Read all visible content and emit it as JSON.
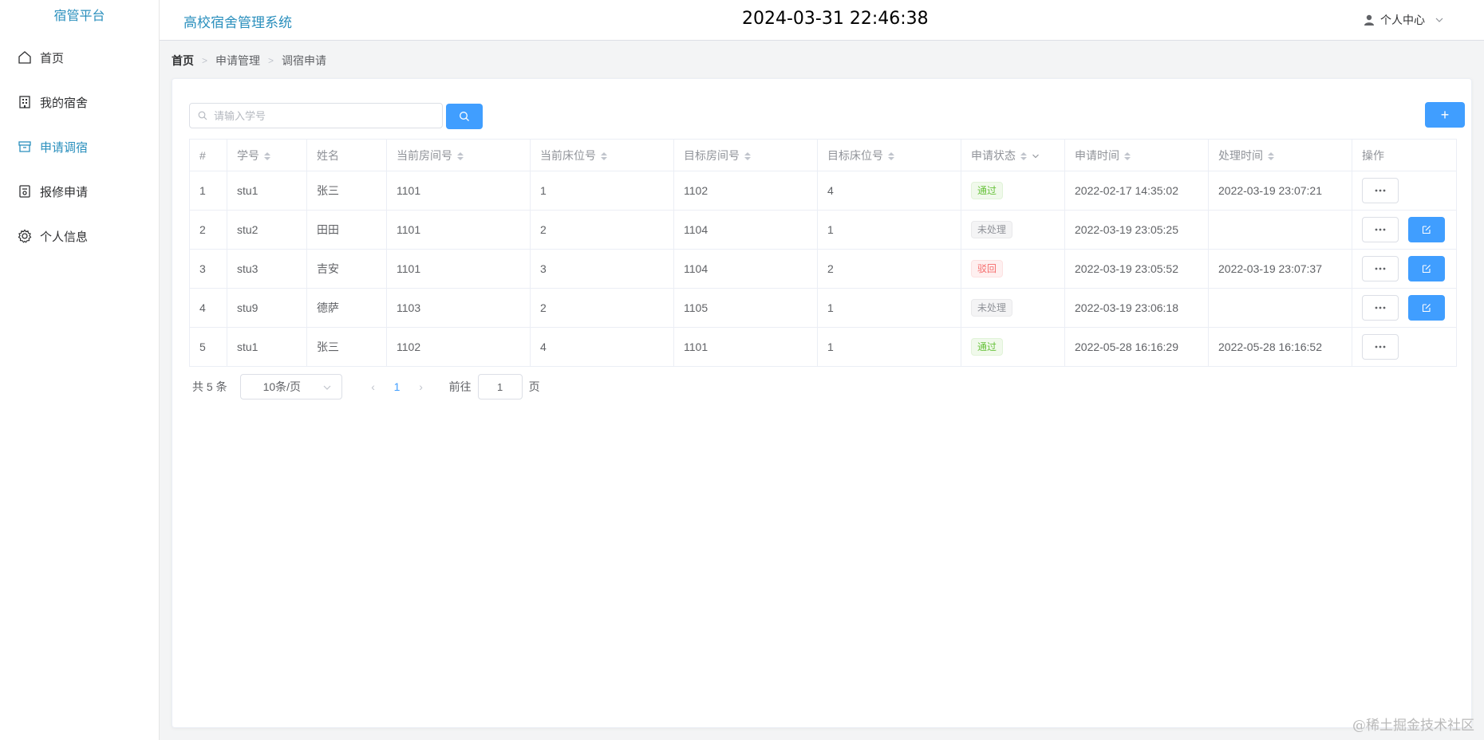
{
  "sidebar": {
    "brand": "宿管平台",
    "items": [
      {
        "label": "首页",
        "icon": "home-icon",
        "active": false
      },
      {
        "label": "我的宿舍",
        "icon": "building-icon",
        "active": false
      },
      {
        "label": "申请调宿",
        "icon": "box-icon",
        "active": true
      },
      {
        "label": "报修申请",
        "icon": "wrench-icon",
        "active": false
      },
      {
        "label": "个人信息",
        "icon": "gear-icon",
        "active": false
      }
    ]
  },
  "header": {
    "title": "高校宿舍管理系统",
    "clock": "2024-03-31 22:46:38",
    "user_center": "个人中心"
  },
  "breadcrumb": [
    "首页",
    "申请管理",
    "调宿申请"
  ],
  "search": {
    "placeholder": "请输入学号",
    "value": ""
  },
  "add_button": "+",
  "table": {
    "columns": [
      "#",
      "学号",
      "姓名",
      "当前房间号",
      "当前床位号",
      "目标房间号",
      "目标床位号",
      "申请状态",
      "申请时间",
      "处理时间",
      "操作"
    ],
    "rows": [
      {
        "index": "1",
        "student_id": "stu1",
        "name": "张三",
        "cur_room": "1101",
        "cur_bed": "1",
        "target_room": "1102",
        "target_bed": "4",
        "status": "通过",
        "status_type": "success",
        "apply_time": "2022-02-17 14:35:02",
        "process_time": "2022-03-19 23:07:21",
        "editable": false
      },
      {
        "index": "2",
        "student_id": "stu2",
        "name": "田田",
        "cur_room": "1101",
        "cur_bed": "2",
        "target_room": "1104",
        "target_bed": "1",
        "status": "未处理",
        "status_type": "info",
        "apply_time": "2022-03-19 23:05:25",
        "process_time": "",
        "editable": true
      },
      {
        "index": "3",
        "student_id": "stu3",
        "name": "吉安",
        "cur_room": "1101",
        "cur_bed": "3",
        "target_room": "1104",
        "target_bed": "2",
        "status": "驳回",
        "status_type": "danger",
        "apply_time": "2022-03-19 23:05:52",
        "process_time": "2022-03-19 23:07:37",
        "editable": true
      },
      {
        "index": "4",
        "student_id": "stu9",
        "name": "德萨",
        "cur_room": "1103",
        "cur_bed": "2",
        "target_room": "1105",
        "target_bed": "1",
        "status": "未处理",
        "status_type": "info",
        "apply_time": "2022-03-19 23:06:18",
        "process_time": "",
        "editable": true
      },
      {
        "index": "5",
        "student_id": "stu1",
        "name": "张三",
        "cur_room": "1102",
        "cur_bed": "4",
        "target_room": "1101",
        "target_bed": "1",
        "status": "通过",
        "status_type": "success",
        "apply_time": "2022-05-28 16:16:29",
        "process_time": "2022-05-28 16:16:52",
        "editable": false
      }
    ]
  },
  "pagination": {
    "total": "共 5 条",
    "page_size": "10条/页",
    "current_page": "1",
    "goto_label": "前往",
    "goto_value": "1",
    "page_label": "页"
  },
  "watermark": "@稀土掘金技术社区",
  "colors": {
    "primary": "#409eff",
    "brand": "#2a8fbd",
    "success": "#67c23a",
    "danger": "#f56c6c",
    "info": "#909399"
  }
}
